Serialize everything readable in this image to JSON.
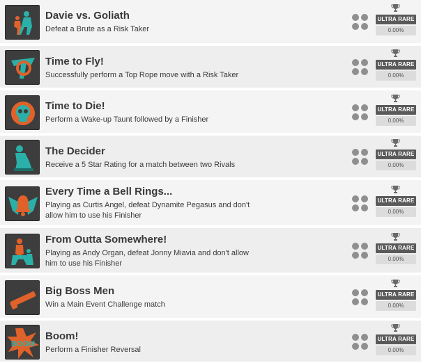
{
  "achievements": [
    {
      "title": "Davie vs. Goliath",
      "desc": "Defeat a Brute as a Risk Taker",
      "rarity": "ULTRA RARE",
      "percent": "0.00%",
      "icon": "two-fighters-icon",
      "colors": [
        "#2ab0a8",
        "#e0622a"
      ]
    },
    {
      "title": "Time to Fly!",
      "desc": "Successfully perform a Top Rope move with a Risk Taker",
      "rarity": "ULTRA RARE",
      "percent": "0.00%",
      "icon": "flying-wrestler-icon",
      "colors": [
        "#2ab0a8",
        "#e0622a"
      ]
    },
    {
      "title": "Time to Die!",
      "desc": "Perform a Wake-up Taunt followed by a Finisher",
      "rarity": "ULTRA RARE",
      "percent": "0.00%",
      "icon": "skull-icon",
      "colors": [
        "#2ab0a8",
        "#e0622a"
      ]
    },
    {
      "title": "The Decider",
      "desc": "Receive a 5 Star Rating for a match between two Rivals",
      "rarity": "ULTRA RARE",
      "percent": "0.00%",
      "icon": "thinker-icon",
      "colors": [
        "#2ab0a8",
        "#e0622a"
      ]
    },
    {
      "title": "Every Time a Bell Rings...",
      "desc": "Playing as Curtis Angel, defeat Dynamite Pegasus and don't allow him to use his Finisher",
      "rarity": "ULTRA RARE",
      "percent": "0.00%",
      "icon": "winged-bell-icon",
      "colors": [
        "#2ab0a8",
        "#e0622a"
      ]
    },
    {
      "title": "From Outta Somewhere!",
      "desc": "Playing as Andy Organ, defeat Jonny Miavia and don't allow him to use his Finisher",
      "rarity": "ULTRA RARE",
      "percent": "0.00%",
      "icon": "two-wrestlers-icon",
      "colors": [
        "#2ab0a8",
        "#e0622a"
      ]
    },
    {
      "title": "Big Boss Men",
      "desc": "Win a Main Event Challenge match",
      "rarity": "ULTRA RARE",
      "percent": "0.00%",
      "icon": "baton-icon",
      "colors": [
        "#2ab0a8",
        "#e0622a"
      ]
    },
    {
      "title": "Boom!",
      "desc": "Perform a Finisher Reversal",
      "rarity": "ULTRA RARE",
      "percent": "0.00%",
      "icon": "boom-icon",
      "colors": [
        "#2ab0a8",
        "#e0622a"
      ]
    }
  ]
}
